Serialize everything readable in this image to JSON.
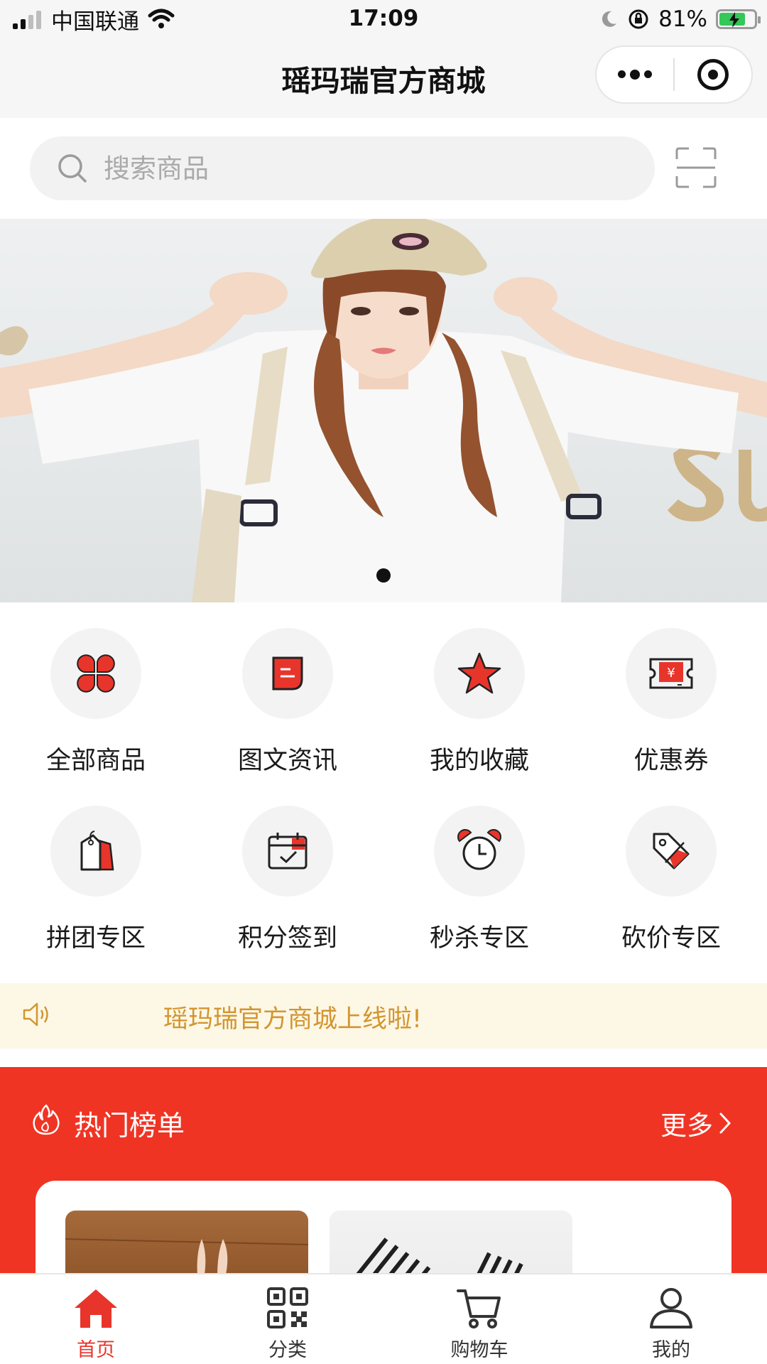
{
  "status_bar": {
    "carrier": "中国联通",
    "time": "17:09",
    "battery": "81%"
  },
  "nav": {
    "title": "瑶玛瑞官方商城"
  },
  "search": {
    "placeholder": "搜索商品"
  },
  "banner": {
    "slide_count": 1,
    "active_slide": 1
  },
  "grid": {
    "items": [
      {
        "label": "全部商品",
        "icon": "all-products-icon"
      },
      {
        "label": "图文资讯",
        "icon": "news-icon"
      },
      {
        "label": "我的收藏",
        "icon": "star-icon"
      },
      {
        "label": "优惠券",
        "icon": "coupon-icon"
      },
      {
        "label": "拼团专区",
        "icon": "group-buy-icon"
      },
      {
        "label": "积分签到",
        "icon": "calendar-checkin-icon"
      },
      {
        "label": "秒杀专区",
        "icon": "alarm-clock-icon"
      },
      {
        "label": "砍价专区",
        "icon": "price-tag-icon"
      }
    ]
  },
  "notice": {
    "text": "瑶玛瑞官方商城上线啦!"
  },
  "hot": {
    "title": "热门榜单",
    "more": "更多"
  },
  "tabbar": {
    "items": [
      {
        "label": "首页",
        "icon": "home-icon",
        "active": true
      },
      {
        "label": "分类",
        "icon": "qrcode-grid-icon",
        "active": false
      },
      {
        "label": "购物车",
        "icon": "cart-icon",
        "active": false
      },
      {
        "label": "我的",
        "icon": "user-icon",
        "active": false
      }
    ]
  },
  "colors": {
    "accent": "#e8352b",
    "hot_bg": "#f03424",
    "notice_bg": "#fdf7e6",
    "notice_text": "#d2962f"
  }
}
